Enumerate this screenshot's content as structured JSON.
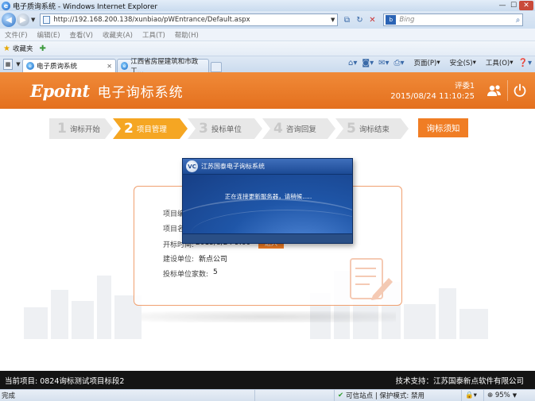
{
  "window": {
    "title": "电子质询系统 - Windows Internet Explorer"
  },
  "address_bar": {
    "url": "http://192.168.200.138/xunbiao/pWEntrance/Default.aspx",
    "search_placeholder": "Bing"
  },
  "menu": [
    "文件(F)",
    "编辑(E)",
    "查看(V)",
    "收藏夹(A)",
    "工具(T)",
    "帮助(H)"
  ],
  "favorites": {
    "label": "收藏夹"
  },
  "tabs": [
    {
      "label": "电子质询系统",
      "active": true
    },
    {
      "label": "江西省房屋建筑和市政工...",
      "active": false
    }
  ],
  "command_bar": {
    "page": "页面(P)",
    "safety": "安全(S)",
    "tools": "工具(O)"
  },
  "app": {
    "logo": "Epoint",
    "title": "电子询标系统",
    "user": "评委1",
    "datetime": "2015/08/24 11:10:25",
    "accent_color": "#e4701e"
  },
  "steps": [
    {
      "num": "1",
      "label": "询标开始",
      "active": false
    },
    {
      "num": "2",
      "label": "项目管理",
      "active": true
    },
    {
      "num": "3",
      "label": "投标单位",
      "active": false
    },
    {
      "num": "4",
      "label": "咨询回复",
      "active": false
    },
    {
      "num": "5",
      "label": "询标结束",
      "active": false
    }
  ],
  "notice_button": "询标须知",
  "project_info": {
    "row1_label": "项目编",
    "row2_label": "项目名",
    "open_time_label": "开标时间:",
    "open_time_value": "2015/8/24 9:00",
    "enter_button": "进入",
    "builder_label": "建设单位:",
    "builder_value": "新点公司",
    "bidder_count_label": "投标单位家数:",
    "bidder_count_value": "5"
  },
  "modal": {
    "title": "江苏国泰电子询标系统",
    "logo": "VC",
    "message": "正在连接更新服务器，请稍候....."
  },
  "footer": {
    "current_project": "当前项目:  0824询标测试项目标段2",
    "support": "技术支持：江苏国泰新点软件有限公司"
  },
  "status_bar": {
    "done": "完成",
    "trusted": "可信站点 | 保护模式: 禁用",
    "zoom": "95%"
  }
}
